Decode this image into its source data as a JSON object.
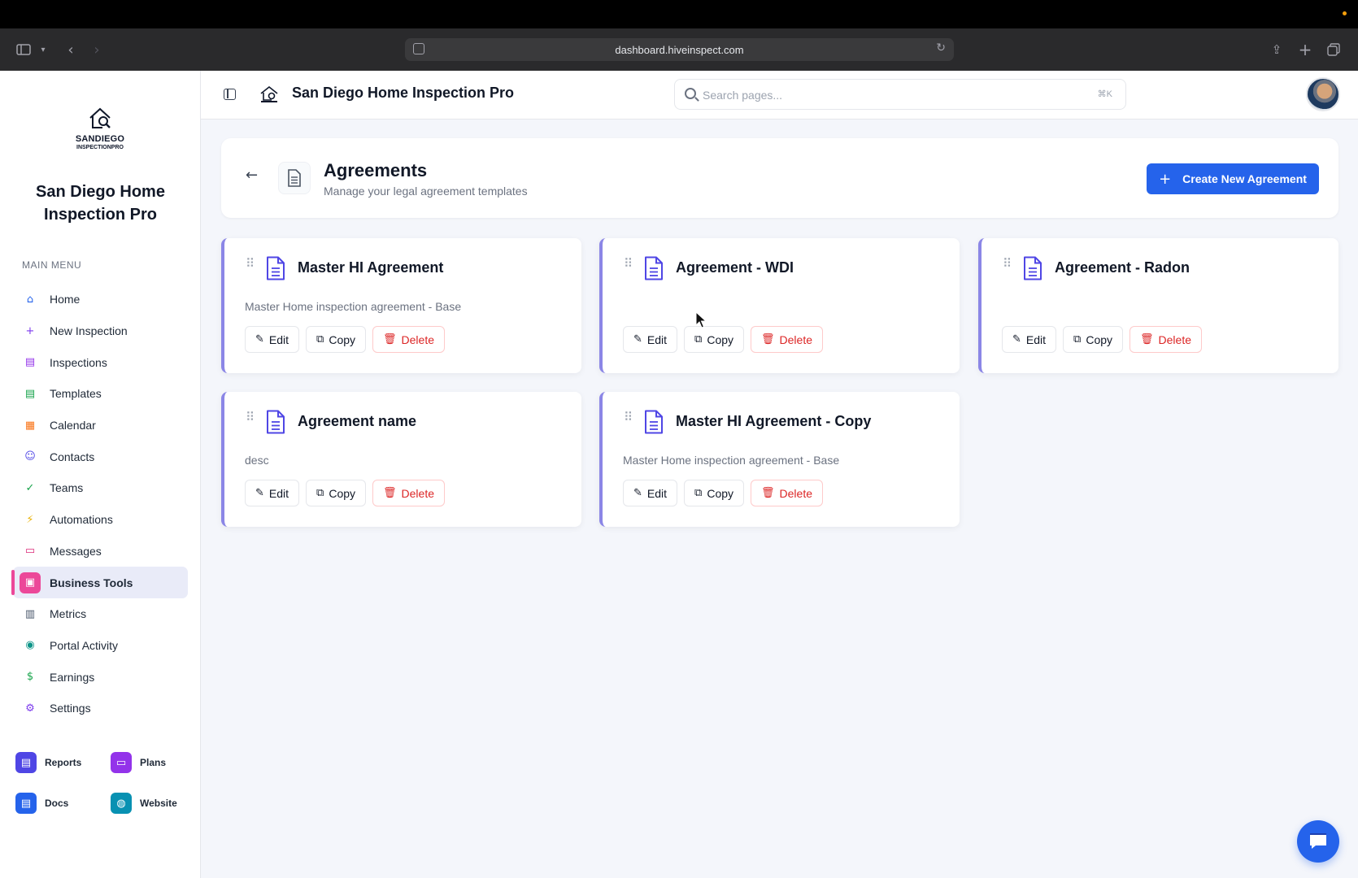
{
  "browser": {
    "url": "dashboard.hiveinspect.com"
  },
  "sidebar": {
    "logo_text_1": "SANDIEGO",
    "logo_text_2": "INSPECTIONPRO",
    "brand_name": "San Diego Home Inspection Pro",
    "menu_label": "MAIN MENU",
    "items": [
      {
        "label": "Home",
        "icon": "home-icon",
        "color": "#2563eb",
        "glyph": "⌂"
      },
      {
        "label": "New Inspection",
        "icon": "plus-icon",
        "color": "#7c3aed",
        "glyph": "+"
      },
      {
        "label": "Inspections",
        "icon": "clipboard-icon",
        "color": "#9333ea",
        "glyph": "▤"
      },
      {
        "label": "Templates",
        "icon": "file-icon",
        "color": "#16a34a",
        "glyph": "▤"
      },
      {
        "label": "Calendar",
        "icon": "calendar-icon",
        "color": "#f97316",
        "glyph": "▦"
      },
      {
        "label": "Contacts",
        "icon": "users-icon",
        "color": "#4f46e5",
        "glyph": "☺"
      },
      {
        "label": "Teams",
        "icon": "user-check-icon",
        "color": "#16a34a",
        "glyph": "✓"
      },
      {
        "label": "Automations",
        "icon": "lightning-icon",
        "color": "#eab308",
        "glyph": "⚡"
      },
      {
        "label": "Messages",
        "icon": "message-icon",
        "color": "#db2777",
        "glyph": "▭"
      },
      {
        "label": "Business Tools",
        "icon": "briefcase-icon",
        "color": "#ec4899",
        "glyph": "▣"
      },
      {
        "label": "Metrics",
        "icon": "bar-chart-icon",
        "color": "#475569",
        "glyph": "▥"
      },
      {
        "label": "Portal Activity",
        "icon": "eye-icon",
        "color": "#0d9488",
        "glyph": "◉"
      },
      {
        "label": "Earnings",
        "icon": "dollar-icon",
        "color": "#16a34a",
        "glyph": "$"
      },
      {
        "label": "Settings",
        "icon": "gear-icon",
        "color": "#7c3aed",
        "glyph": "⚙"
      }
    ],
    "active_item": "Business Tools",
    "quick_links": [
      {
        "label": "Reports",
        "icon": "report-icon",
        "color": "#4f46e5"
      },
      {
        "label": "Plans",
        "icon": "card-icon",
        "color": "#9333ea"
      },
      {
        "label": "Docs",
        "icon": "doc-icon",
        "color": "#2563eb"
      },
      {
        "label": "Website",
        "icon": "globe-icon",
        "color": "#0891b2"
      }
    ]
  },
  "header": {
    "title": "San Diego Home Inspection Pro",
    "search_placeholder": "Search pages...",
    "search_shortcut": "⌘K"
  },
  "page": {
    "title": "Agreements",
    "subtitle": "Manage your legal agreement templates",
    "create_button": "Create New Agreement"
  },
  "buttons": {
    "edit": "Edit",
    "copy": "Copy",
    "delete": "Delete"
  },
  "agreements": [
    {
      "title": "Master HI Agreement",
      "description": "Master Home inspection agreement - Base"
    },
    {
      "title": "Agreement - WDI",
      "description": ""
    },
    {
      "title": "Agreement - Radon",
      "description": ""
    },
    {
      "title": "Agreement name",
      "description": "desc"
    },
    {
      "title": "Master HI Agreement - Copy",
      "description": "Master Home inspection agreement - Base"
    }
  ],
  "colors": {
    "accent": "#2563eb",
    "active_nav": "#ec4899",
    "card_border": "#8b86e6",
    "danger": "#dc2626"
  }
}
